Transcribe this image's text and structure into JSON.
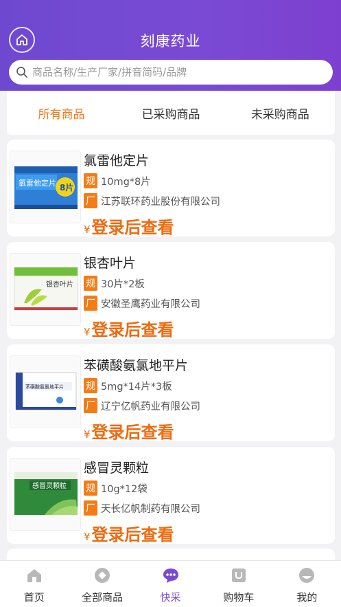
{
  "header": {
    "title": "刻康药业",
    "home_icon": "home-icon",
    "gradient_start": "#6e49cf",
    "gradient_end": "#7d3fcf"
  },
  "search": {
    "placeholder": "商品名称/生产厂家/拼音简码/品牌",
    "value": "",
    "icon": "search-icon"
  },
  "tabs": [
    {
      "label": "所有商品",
      "active": true
    },
    {
      "label": "已采购商品",
      "active": false
    },
    {
      "label": "未采购商品",
      "active": false
    }
  ],
  "labels": {
    "spec_tag": "规",
    "maker_tag": "厂",
    "currency": "¥"
  },
  "products": [
    {
      "name": "氯雷他定片",
      "spec": "10mg*8片",
      "manufacturer": "江苏联环药业股份有限公司",
      "price_text": "登录后查看",
      "box_text": "氯雷他定片",
      "box_badge": "8片"
    },
    {
      "name": "银杏叶片",
      "spec": "30片*2板",
      "manufacturer": "安徽圣鹰药业有限公司",
      "price_text": "登录后查看",
      "box_text": "银杏叶片"
    },
    {
      "name": "苯磺酸氨氯地平片",
      "spec": "5mg*14片*3板",
      "manufacturer": "辽宁亿帆药业有限公司",
      "price_text": "登录后查看",
      "box_text": "苯磺酸氨氯地平片"
    },
    {
      "name": "感冒灵颗粒",
      "spec": "10g*12袋",
      "manufacturer": "天长亿帆制药有限公司",
      "price_text": "登录后查看",
      "box_text": "感冒灵颗粒"
    }
  ],
  "tabbar": [
    {
      "label": "首页",
      "icon": "home-icon",
      "active": false
    },
    {
      "label": "全部商品",
      "icon": "grid-icon",
      "active": false
    },
    {
      "label": "快采",
      "icon": "chat-icon",
      "active": true
    },
    {
      "label": "购物车",
      "icon": "cart-icon",
      "active": false
    },
    {
      "label": "我的",
      "icon": "user-icon",
      "active": false
    }
  ],
  "colors": {
    "accent": "#7b4ad4",
    "orange": "#f47c17",
    "price": "#f06a0e",
    "tab_active": "#f27a1a"
  }
}
